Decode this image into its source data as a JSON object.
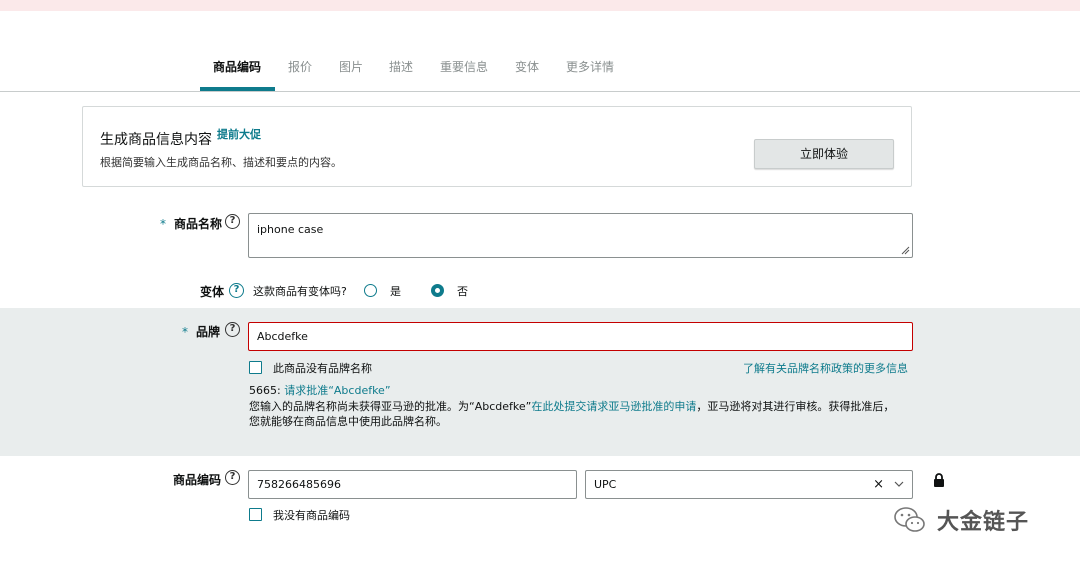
{
  "tabs": [
    {
      "label": "商品编码",
      "active": true
    },
    {
      "label": "报价"
    },
    {
      "label": "图片"
    },
    {
      "label": "描述"
    },
    {
      "label": "重要信息"
    },
    {
      "label": "变体"
    },
    {
      "label": "更多详情"
    }
  ],
  "generator": {
    "title": "生成商品信息内容",
    "badge": "提前大促",
    "description": "根据简要输入生成商品名称、描述和要点的内容。",
    "button": "立即体验"
  },
  "product_name": {
    "required_mark": "*",
    "label": "商品名称",
    "value": "iphone case"
  },
  "variant": {
    "label": "变体",
    "question": "这款商品有变体吗?",
    "options": [
      {
        "label": "是",
        "selected": false
      },
      {
        "label": "否",
        "selected": true
      }
    ]
  },
  "brand": {
    "required_mark": "*",
    "label": "品牌",
    "value": "Abcdefke",
    "no_brand_label": "此商品没有品牌名称",
    "policy_link": "了解有关品牌名称政策的更多信息",
    "code_prefix": "5665:",
    "request_link": "请求批准“Abcdefke”",
    "message_part1": "您输入的品牌名称尚未获得亚马逊的批准。为“Abcdefke”",
    "message_link": "在此处提交请求亚马逊批准的申请",
    "message_part2": "，亚马逊将对其进行审核。获得批准后，",
    "message_line2": "您就能够在商品信息中使用此品牌名称。"
  },
  "product_id": {
    "label": "商品编码",
    "value": "758266485696",
    "type_value": "UPC",
    "clear_symbol": "×",
    "no_id_label": "我没有商品编码"
  },
  "watermark": {
    "text": "大金链子"
  },
  "icons": {
    "help": "help-circle-icon",
    "lock": "lock-icon",
    "chevron": "chevron-down-icon",
    "wechat": "wechat-icon"
  },
  "colors": {
    "accent": "#0e7b8c",
    "error": "#c40000",
    "panel": "#e9eded"
  }
}
